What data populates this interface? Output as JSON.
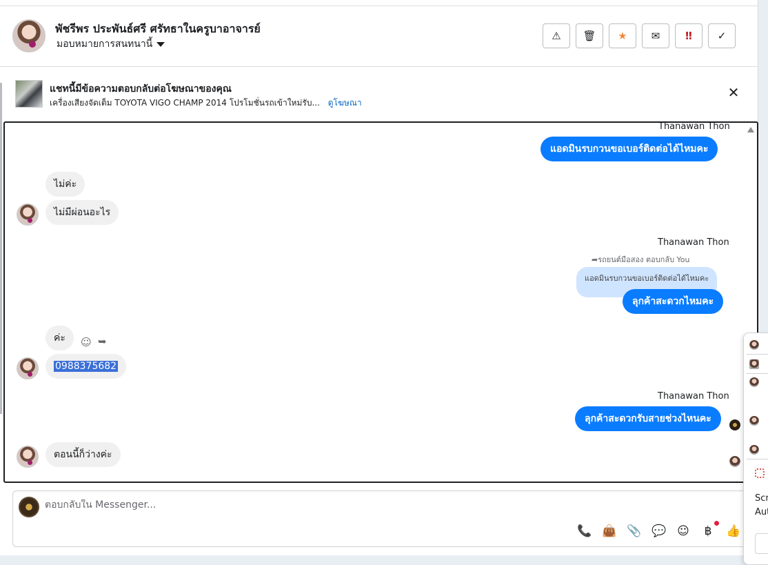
{
  "header": {
    "contact_name": "พัชรีพร ประพันธ์ศรี ศรัทธาในครูบาอาจารย์",
    "assign_label": "มอบหมายการสนทนานี้",
    "tools": [
      {
        "icon": "warning-icon",
        "glyph": "⚠"
      },
      {
        "icon": "trash-icon",
        "glyph": "🗑"
      },
      {
        "icon": "star-icon",
        "glyph": "★"
      },
      {
        "icon": "envelope-open-icon",
        "glyph": "✉"
      },
      {
        "icon": "urgent-icon",
        "glyph": "‼"
      },
      {
        "icon": "check-icon",
        "glyph": "✓"
      }
    ]
  },
  "ad_banner": {
    "title": "แชทนี้มีข้อความตอบกลับต่อโฆษณาของคุณ",
    "subtitle": "เครื่องเสียงจัดเต็ม TOYOTA VIGO CHAMP 2014 โปรโมชั่นรถเข้าใหม่รับ...",
    "link": "ดูโฆษณา",
    "close_glyph": "✕"
  },
  "messages": {
    "m1_sender": "Thanawan Thon",
    "m1_text": "แอดมินรบกวนขอเบอร์ติดต่อได้ไหมคะ",
    "m2_text": "ไม่ค่ะ",
    "m3_text": "ไม่มีผ่อนอะไร",
    "m4_sender": "Thanawan Thon",
    "m4_reply_note": "รถยนต์มือสอง ตอบกลับ You",
    "m4_quote": "แอดมินรบกวนขอเบอร์ติดต่อได้ไหมคะ",
    "m4_text": "ลุกค้าสะดวกไหมคะ",
    "m5_text": "ค่ะ",
    "m6_text": "0988375682",
    "m7_sender": "Thanawan Thon",
    "m7_text": "ลุกค้าสะดวกรับสายช่วงไหนคะ",
    "m8_text": "ตอนนี้ก็ว่างค่ะ"
  },
  "composer": {
    "placeholder": "ตอบกลับใน Messenger...",
    "tools": [
      {
        "icon": "phone-plus-icon",
        "glyph": "📞"
      },
      {
        "icon": "shopping-bag-icon",
        "glyph": "👜"
      },
      {
        "icon": "paperclip-icon",
        "glyph": "📎"
      },
      {
        "icon": "chat-bubble-icon",
        "glyph": "💬"
      },
      {
        "icon": "emoji-icon",
        "glyph": "☺"
      },
      {
        "icon": "baht-icon",
        "glyph": "฿"
      },
      {
        "icon": "thumbs-up-icon",
        "glyph": "👍"
      }
    ]
  },
  "mini_panel": {
    "text1": "Scr",
    "text2": "Aut"
  }
}
